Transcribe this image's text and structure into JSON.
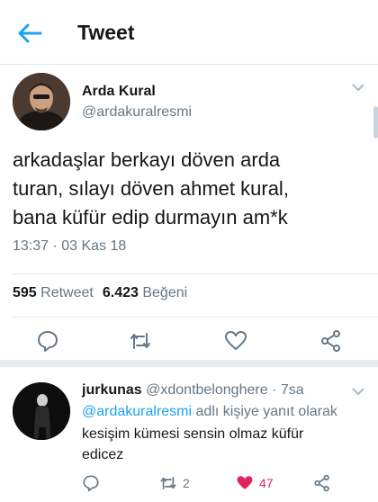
{
  "colors": {
    "accent": "#1da1f2",
    "like": "#e0245e",
    "muted": "#657786",
    "text": "#14171a"
  },
  "header": {
    "title": "Tweet",
    "back_icon": "arrow-left-icon"
  },
  "tweet": {
    "display_name": "Arda Kural",
    "handle": "@ardakuralresmi",
    "text_lines": [
      "arkadaşlar berkayı döven arda",
      "turan, sılayı döven ahmet kural,",
      "bana küfür edip durmayın am*k"
    ],
    "timestamp": "13:37 · 03 Kas 18",
    "retweet_count": "595",
    "retweet_label": "Retweet",
    "like_count": "6.423",
    "like_label": "Beğeni",
    "action_icons": [
      "reply-icon",
      "retweet-icon",
      "heart-icon",
      "share-icon"
    ]
  },
  "reply": {
    "display_name": "jurkunas",
    "handle": "@xdontbelonghere",
    "time": "· 7sa",
    "mention": "@ardakuralresmi",
    "reply_to_suffix": "adlı kişiye yanıt olarak",
    "text_lines": [
      "kesişim kümesi sensin olmaz küfür",
      "edicez"
    ],
    "retweet_count": "2",
    "like_count": "47",
    "liked": true
  }
}
